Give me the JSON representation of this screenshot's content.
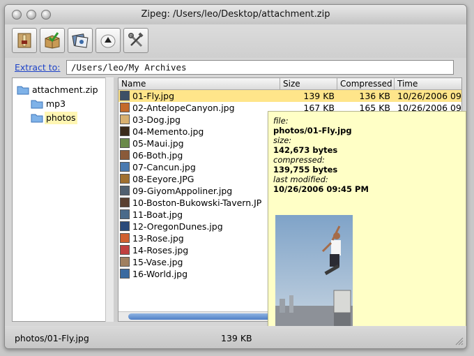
{
  "window": {
    "title": "Zipeg: /Users/leo/Desktop/attachment.zip"
  },
  "toolbar": {
    "buttons": [
      {
        "icon": "extract-icon"
      },
      {
        "icon": "package-check-icon"
      },
      {
        "icon": "preview-icon"
      },
      {
        "icon": "up-arrow-icon"
      },
      {
        "icon": "tools-icon"
      }
    ]
  },
  "extract": {
    "link_label": "Extract to:",
    "path_value": "/Users/leo/My Archives"
  },
  "tree": {
    "items": [
      {
        "label": "attachment.zip"
      },
      {
        "label": "mp3"
      },
      {
        "label": "photos"
      }
    ]
  },
  "table": {
    "columns": [
      "Name",
      "Size",
      "Compressed",
      "Time"
    ],
    "rows": [
      {
        "name": "01-Fly.jpg",
        "size": "139 KB",
        "comp": "136 KB",
        "time": "10/26/2006 09"
      },
      {
        "name": "02-AntelopeCanyon.jpg",
        "size": "167 KB",
        "comp": "165 KB",
        "time": "10/26/2006 09"
      },
      {
        "name": "03-Dog.jpg",
        "size": "",
        "comp": "",
        "time": ""
      },
      {
        "name": "04-Memento.jpg",
        "size": "",
        "comp": "",
        "time": ""
      },
      {
        "name": "05-Maui.jpg",
        "size": "",
        "comp": "",
        "time": ""
      },
      {
        "name": "06-Both.jpg",
        "size": "",
        "comp": "",
        "time": ""
      },
      {
        "name": "07-Cancun.jpg",
        "size": "",
        "comp": "",
        "time": ""
      },
      {
        "name": "08-Eeyore.JPG",
        "size": "",
        "comp": "",
        "time": ""
      },
      {
        "name": "09-GiyomAppoliner.jpg",
        "size": "",
        "comp": "",
        "time": ""
      },
      {
        "name": "10-Boston-Bukowski-Tavern.JP",
        "size": "",
        "comp": "",
        "time": ""
      },
      {
        "name": "11-Boat.jpg",
        "size": "",
        "comp": "",
        "time": ""
      },
      {
        "name": "12-OregonDunes.jpg",
        "size": "",
        "comp": "",
        "time": ""
      },
      {
        "name": "13-Rose.jpg",
        "size": "",
        "comp": "",
        "time": ""
      },
      {
        "name": "14-Roses.jpg",
        "size": "",
        "comp": "",
        "time": ""
      },
      {
        "name": "15-Vase.jpg",
        "size": "",
        "comp": "",
        "time": ""
      },
      {
        "name": "16-World.jpg",
        "size": "",
        "comp": "",
        "time": ""
      }
    ]
  },
  "tooltip": {
    "file_key": "file:",
    "file_val": "photos/01-Fly.jpg",
    "size_key": "size:",
    "size_val": "142,673 bytes",
    "comp_key": "compressed:",
    "comp_val": "139,755 bytes",
    "mod_key": "last modified:",
    "mod_val": "10/26/2006 09:45 PM"
  },
  "status": {
    "path": "photos/01-Fly.jpg",
    "size": "139 KB"
  },
  "colors": {
    "selection": "#ffe58a",
    "tooltip_bg": "#ffffc6",
    "link": "#1f44c8"
  }
}
